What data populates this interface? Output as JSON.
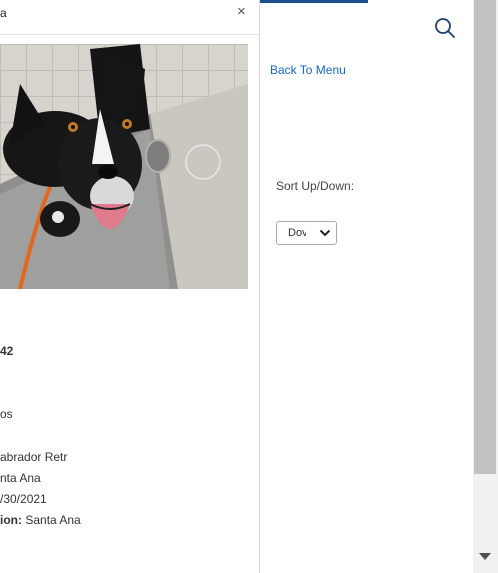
{
  "dialog": {
    "title_fragment": "a",
    "close_label": "×"
  },
  "pet": {
    "photo_alt": "Black and white dog",
    "id_fragment": "42",
    "age_fragment": "os",
    "breed_fragment": "abrador Retr",
    "shelter_fragment": "nta Ana",
    "date_fragment": "/30/2021",
    "location_label_fragment": "ion:",
    "location_value": "Santa Ana"
  },
  "sidebar": {
    "back_label": "Back To Menu",
    "sort_label": "Sort Up/Down:",
    "sort_value": "Dov"
  },
  "icons": {
    "search": "search-icon",
    "chevron": "chevron-down-icon",
    "scroll": "scroll-down-arrow-icon"
  },
  "colors": {
    "accent": "#1f4e8c",
    "link": "#1565c0",
    "scroll_thumb": "#c1c1c1"
  }
}
